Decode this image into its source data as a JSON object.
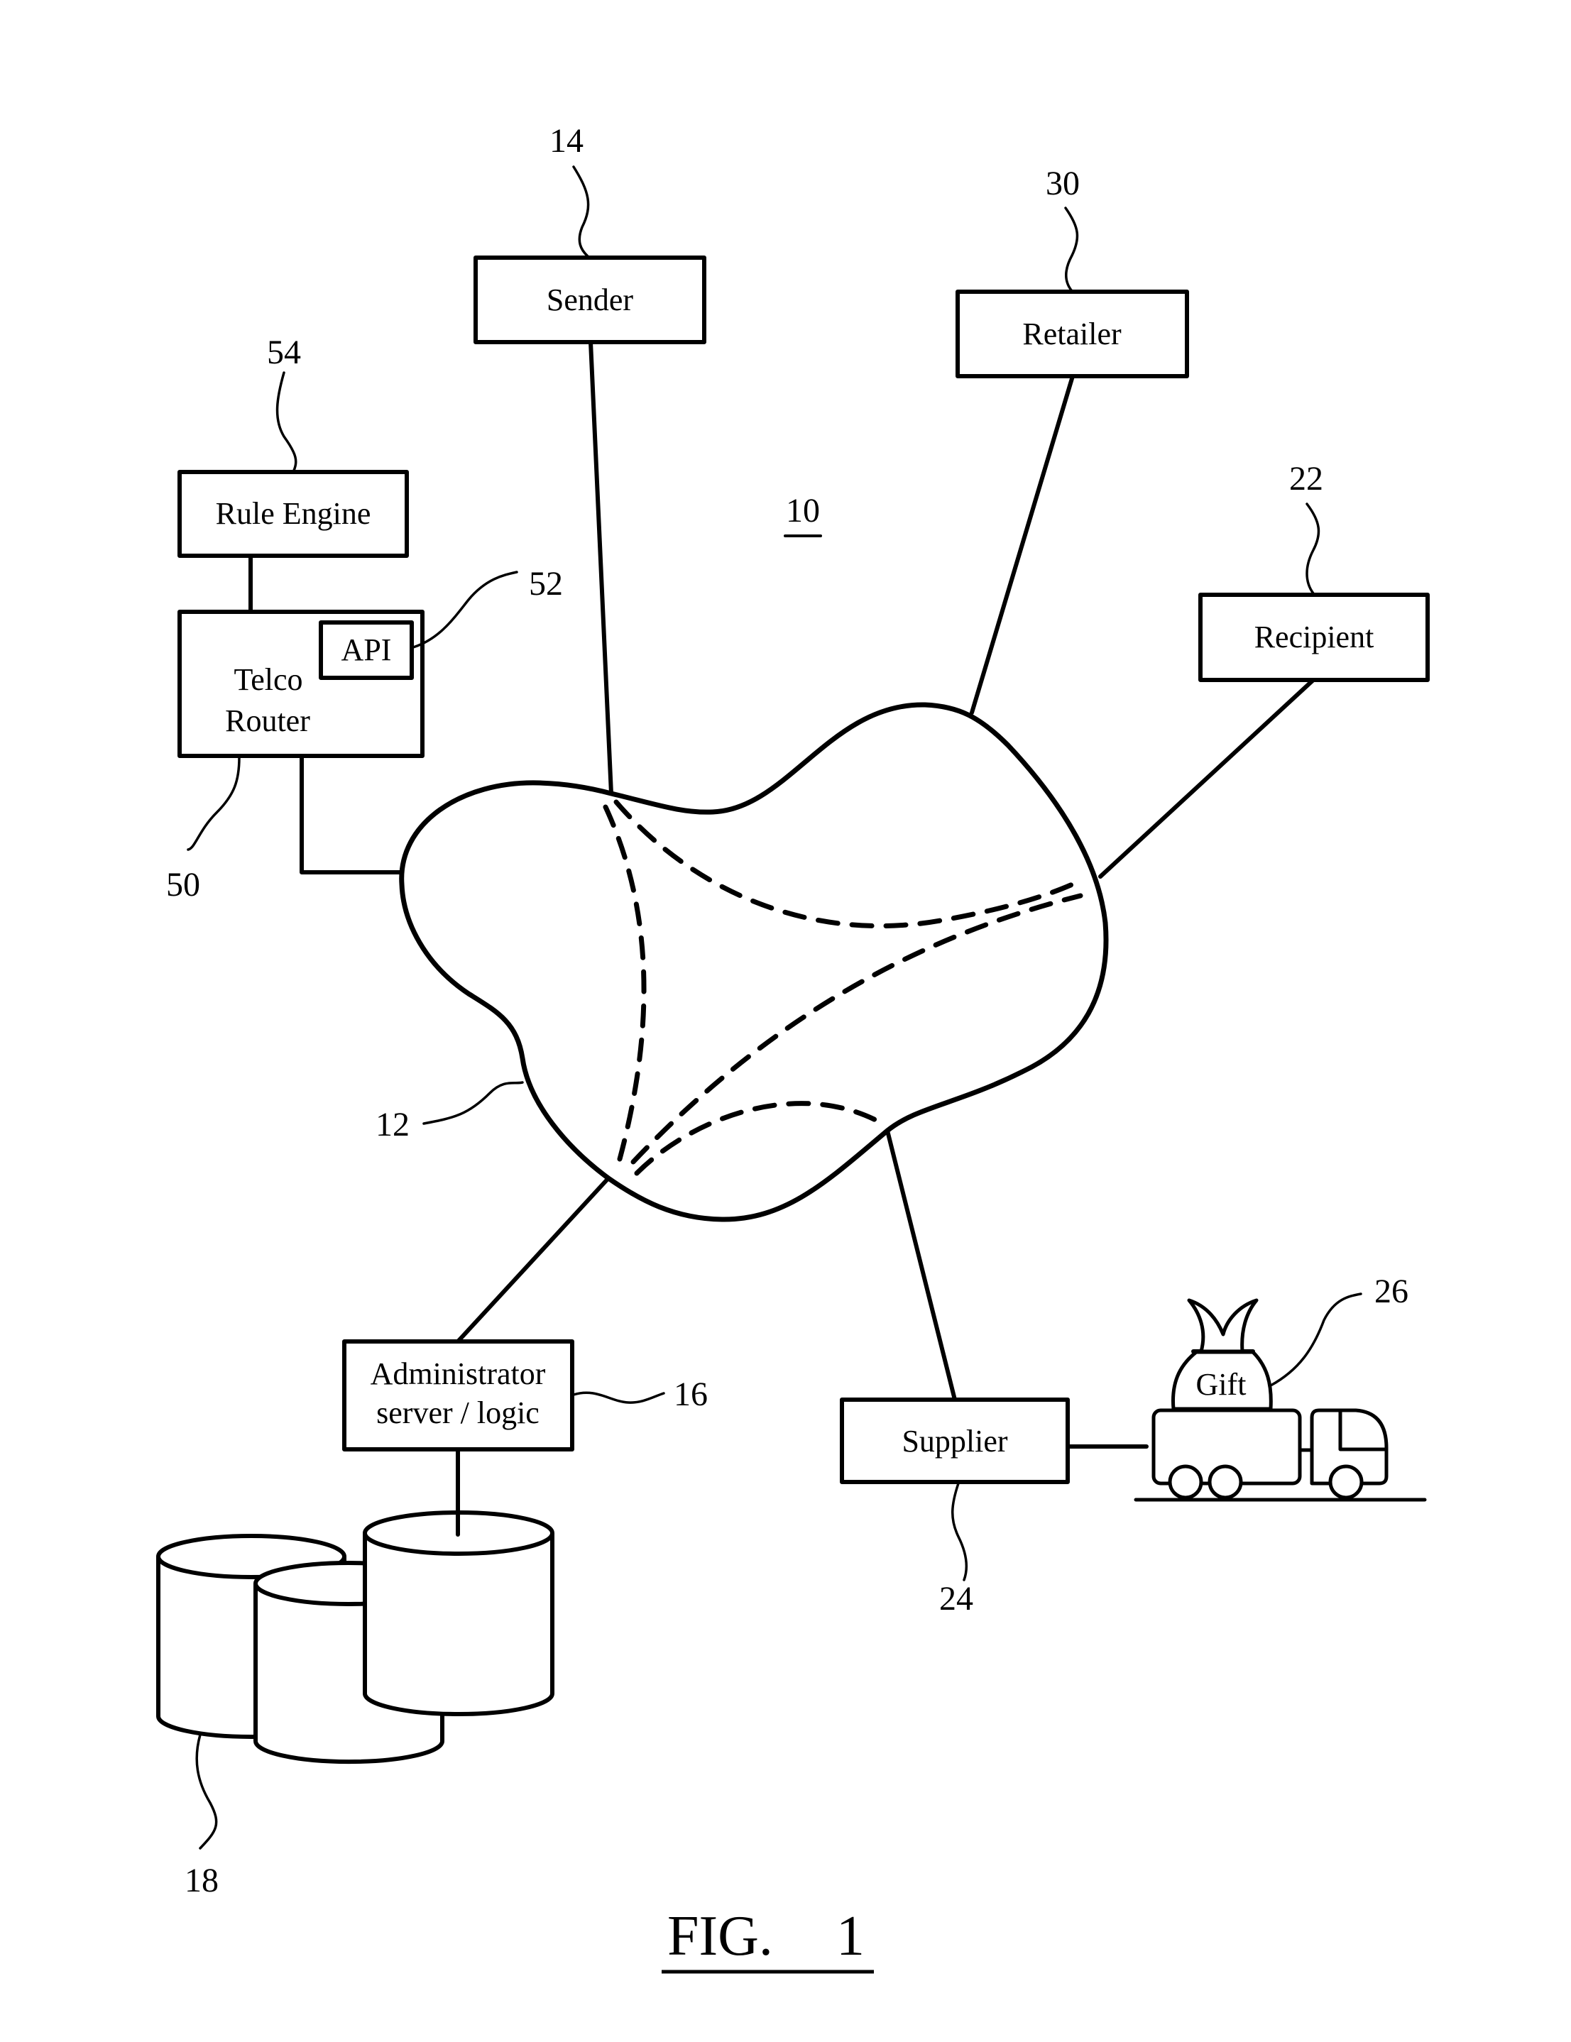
{
  "figure": {
    "caption": "FIG.",
    "number": "1",
    "system_ref": "10"
  },
  "nodes": {
    "sender": {
      "label": "Sender",
      "ref": "14"
    },
    "retailer": {
      "label": "Retailer",
      "ref": "30"
    },
    "recipient": {
      "label": "Recipient",
      "ref": "22"
    },
    "rule_engine": {
      "label": "Rule Engine",
      "ref": "54"
    },
    "telco_router": {
      "label_line1": "Telco",
      "label_line2": "Router",
      "ref": "50"
    },
    "api": {
      "label": "API",
      "ref": "52"
    },
    "network": {
      "ref": "12"
    },
    "administrator": {
      "label_line1": "Administrator",
      "label_line2": "server / logic",
      "ref": "16"
    },
    "databases": {
      "ref": "18"
    },
    "supplier": {
      "label": "Supplier",
      "ref": "24"
    },
    "gift": {
      "label": "Gift",
      "ref": "26"
    }
  }
}
